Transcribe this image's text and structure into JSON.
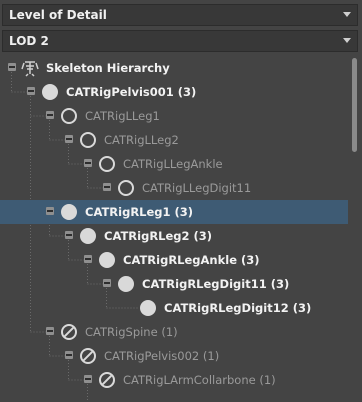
{
  "dropdowns": {
    "level_of_detail": "Level of Detail",
    "lod": "LOD 2"
  },
  "tree": {
    "root_label": "Skeleton Hierarchy",
    "nodes": [
      {
        "label": "CATRigPelvis001 (3)",
        "depth": 1,
        "state": "active",
        "icon": "filled-circle-icon"
      },
      {
        "label": "CATRigLLeg1",
        "depth": 2,
        "state": "inactive",
        "icon": "ring-circle-icon"
      },
      {
        "label": "CATRigLLeg2",
        "depth": 3,
        "state": "inactive",
        "icon": "ring-circle-icon"
      },
      {
        "label": "CATRigLLegAnkle",
        "depth": 4,
        "state": "inactive",
        "icon": "ring-circle-icon"
      },
      {
        "label": "CATRigLLegDigit11",
        "depth": 5,
        "state": "inactive",
        "icon": "ring-circle-icon"
      },
      {
        "label": "CATRigRLeg1 (3)",
        "depth": 2,
        "state": "active",
        "icon": "filled-circle-icon",
        "selected": true
      },
      {
        "label": "CATRigRLeg2 (3)",
        "depth": 3,
        "state": "active",
        "icon": "filled-circle-icon"
      },
      {
        "label": "CATRigRLegAnkle (3)",
        "depth": 4,
        "state": "active",
        "icon": "filled-circle-icon"
      },
      {
        "label": "CATRigRLegDigit11 (3)",
        "depth": 5,
        "state": "active",
        "icon": "filled-circle-icon"
      },
      {
        "label": "CATRigRLegDigit12 (3)",
        "depth": 6,
        "state": "active",
        "icon": "filled-circle-icon"
      },
      {
        "label": "CATRigSpine (1)",
        "depth": 2,
        "state": "inactive",
        "icon": "forbidden-circle-icon"
      },
      {
        "label": "CATRigPelvis002 (1)",
        "depth": 3,
        "state": "inactive",
        "icon": "forbidden-circle-icon"
      },
      {
        "label": "CATRigLArmCollarbone (1)",
        "depth": 4,
        "state": "inactive",
        "icon": "forbidden-circle-icon"
      }
    ]
  },
  "colors": {
    "panel_background": "#444444",
    "selection": "#3e5b74",
    "active_text": "#f2f2f2",
    "inactive_text": "#9a9a9a"
  }
}
